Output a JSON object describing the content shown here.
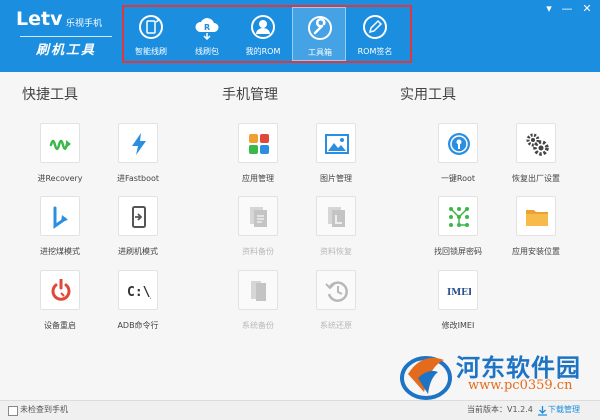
{
  "app": {
    "brand": "Letv",
    "brand_sub": "乐视手机",
    "product": "刷机工具"
  },
  "nav": {
    "items": [
      {
        "label": "智能线刷",
        "icon": "phone-refresh-icon"
      },
      {
        "label": "线刷包",
        "icon": "cloud-download-icon"
      },
      {
        "label": "我的ROM",
        "icon": "user-icon"
      },
      {
        "label": "工具箱",
        "icon": "wrench-icon",
        "active": true
      },
      {
        "label": "ROM签名",
        "icon": "pen-icon"
      }
    ]
  },
  "window": {
    "menu": "▾",
    "minimize": "—",
    "close": "✕"
  },
  "sections": {
    "quick": "快捷工具",
    "phone": "手机管理",
    "utility": "实用工具"
  },
  "tools": {
    "quick": [
      {
        "label": "进Recovery",
        "icon": "recovery-icon"
      },
      {
        "label": "进Fastboot",
        "icon": "lightning-icon"
      },
      {
        "label": "进挖煤模式",
        "icon": "download-mode-icon"
      },
      {
        "label": "进刷机模式",
        "icon": "flash-mode-icon"
      },
      {
        "label": "设备重启",
        "icon": "reboot-icon"
      },
      {
        "label": "ADB命令行",
        "icon": "terminal-icon",
        "text": "C:\\_"
      }
    ],
    "phone": [
      {
        "label": "应用管理",
        "icon": "apps-icon"
      },
      {
        "label": "图片管理",
        "icon": "image-icon"
      },
      {
        "label": "资料备份",
        "icon": "backup-icon",
        "disabled": true
      },
      {
        "label": "资料恢复",
        "icon": "restore-file-icon",
        "disabled": true
      },
      {
        "label": "系统备份",
        "icon": "system-backup-icon",
        "disabled": true
      },
      {
        "label": "系统还原",
        "icon": "system-restore-icon",
        "disabled": true
      }
    ],
    "utility": [
      {
        "label": "一键Root",
        "icon": "root-lock-icon"
      },
      {
        "label": "恢复出厂设置",
        "icon": "gears-icon"
      },
      {
        "label": "找回锁屏密码",
        "icon": "pattern-lock-icon"
      },
      {
        "label": "应用安装位置",
        "icon": "folder-icon"
      },
      {
        "label": "修改IMEI",
        "icon": "imei-icon",
        "text": "IMEI"
      }
    ]
  },
  "footer": {
    "no_phone_label": "未检查到手机",
    "version": "当前版本：V1.2.4",
    "download_manager": "下载管理"
  },
  "watermark": {
    "title": "河东软件园",
    "url": "www.pc0359.cn"
  },
  "colors": {
    "header": "#1b8ee0",
    "highlight_box": "#d9393f",
    "green": "#3cb84a",
    "blue": "#2a8fe0",
    "red": "#e0483a",
    "orange": "#f0a030"
  }
}
